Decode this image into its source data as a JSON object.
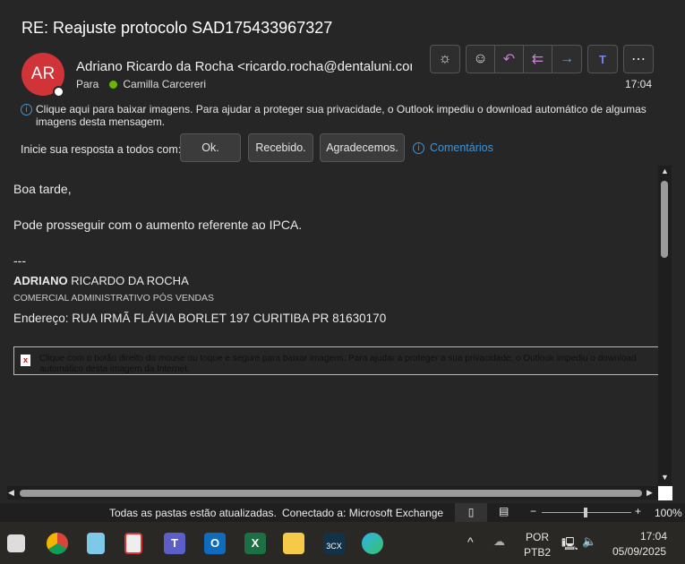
{
  "email": {
    "subject": "RE: Reajuste protocolo SAD175433967327",
    "avatar_initials": "AR",
    "from": "Adriano Ricardo da Rocha <ricardo.rocha@dentaluni.com.br>",
    "to_label": "Para",
    "to": "Camilla Carcereri",
    "time": "17:04",
    "info_bar": "Clique aqui para baixar imagens. Para ajudar a proteger sua privacidade, o Outlook impediu o download automático de algumas imagens desta mensagem."
  },
  "quick_reply": {
    "label": "Inicie sua resposta a todos com:",
    "options": [
      "Ok.",
      "Recebido.",
      "Agradecemos."
    ],
    "feedback": "Comentários"
  },
  "body": {
    "greeting": "Boa tarde,",
    "line1": "Pode prosseguir com o aumento referente ao IPCA.",
    "sep": "---",
    "sig_first": "ADRIANO",
    "sig_rest": " RICARDO DA ROCHA",
    "sig_title": "COMERCIAL ADMINISTRATIVO PÓS VENDAS",
    "sig_address": "Endereço: RUA IRMÃ FLÁVIA BORLET 197 CURITIBA PR 81630170",
    "blocked_image": "Clique com o botão direito do mouse ou toque e segure para baixar imagens. Para ajudar a proteger a sua privacidade, o Outlook impediu o download automático desta imagem da Internet."
  },
  "status": {
    "sync": "Todas as pastas estão atualizadas.",
    "connection": "Conectado a: Microsoft Exchange",
    "zoom": "100%"
  },
  "taskbar": {
    "lang1": "POR",
    "lang2": "PTB2",
    "time": "17:04",
    "date": "05/09/2025",
    "app_3cx": "3CX"
  }
}
